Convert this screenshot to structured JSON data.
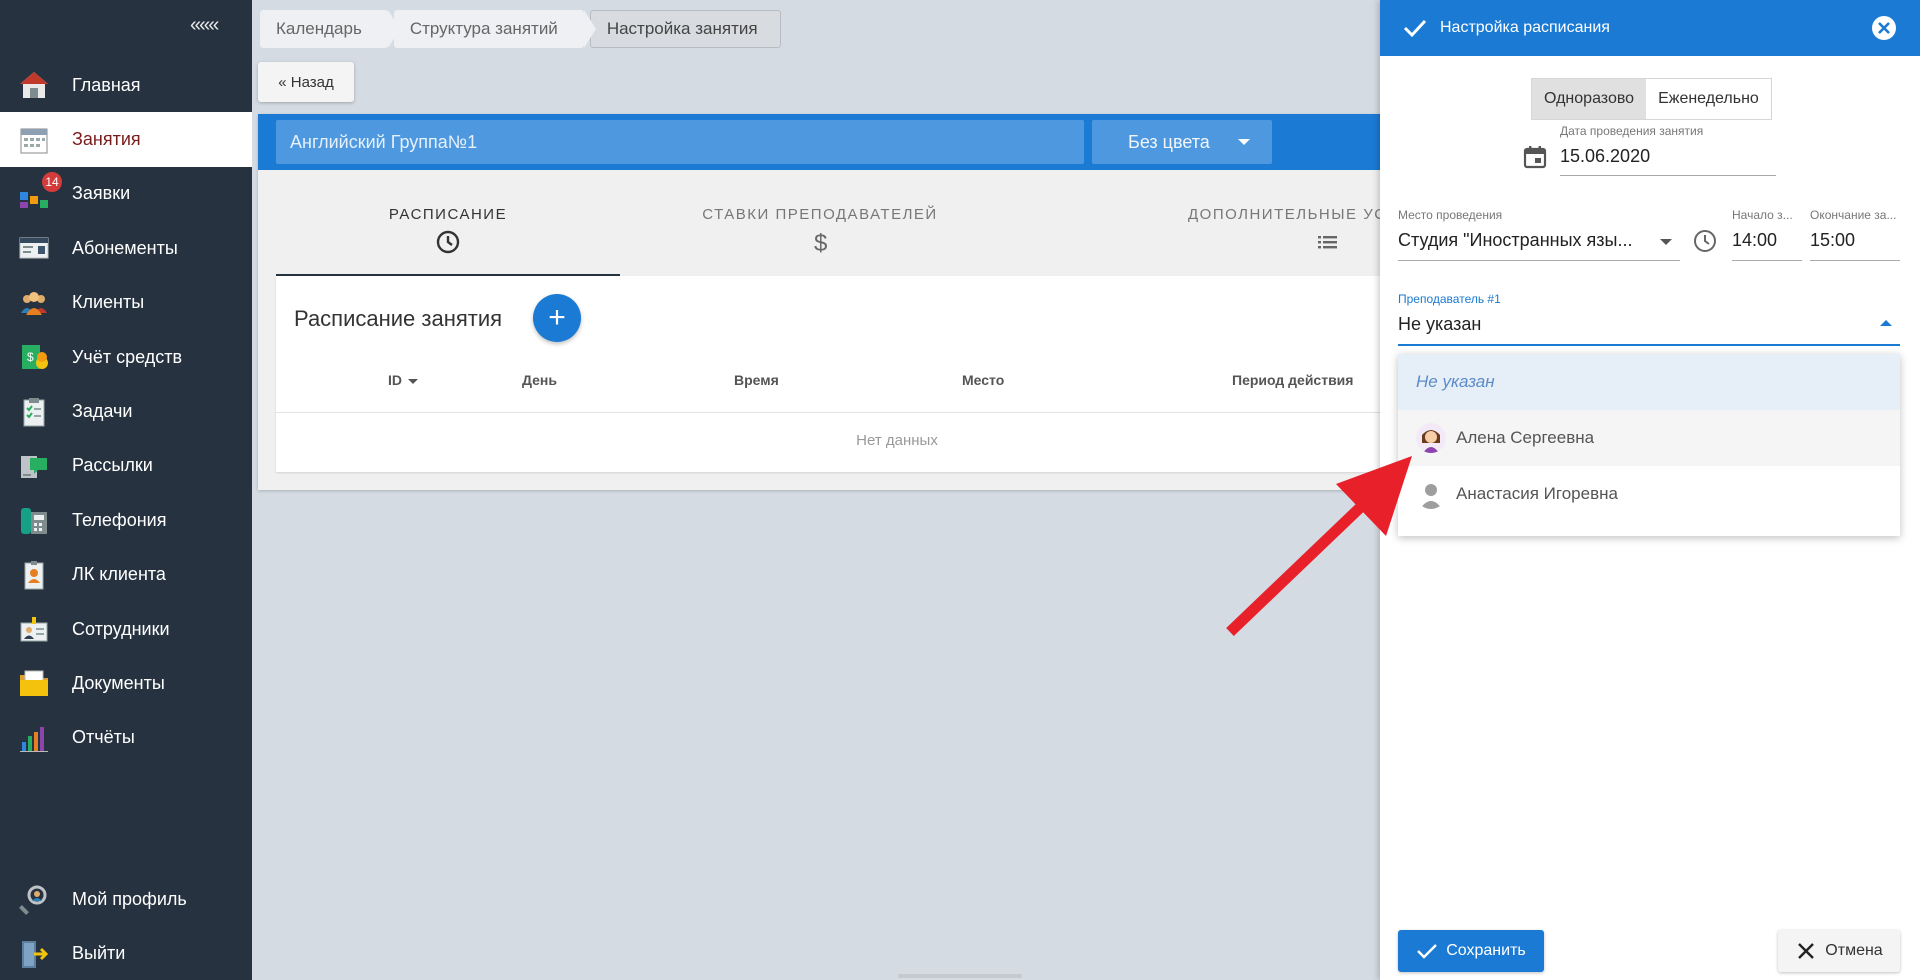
{
  "sidebar": {
    "collapse_label": "«««",
    "items": [
      {
        "label": "Главная",
        "icon": "home-icon"
      },
      {
        "label": "Занятия",
        "icon": "calendar-icon",
        "active": true
      },
      {
        "label": "Заявки",
        "icon": "requests-icon",
        "badge": "14"
      },
      {
        "label": "Абонементы",
        "icon": "subscriptions-icon"
      },
      {
        "label": "Клиенты",
        "icon": "clients-icon"
      },
      {
        "label": "Учёт средств",
        "icon": "finance-icon"
      },
      {
        "label": "Задачи",
        "icon": "tasks-icon"
      },
      {
        "label": "Рассылки",
        "icon": "mailing-icon"
      },
      {
        "label": "Телефония",
        "icon": "telephony-icon"
      },
      {
        "label": "ЛК клиента",
        "icon": "client-account-icon"
      },
      {
        "label": "Сотрудники",
        "icon": "employees-icon"
      },
      {
        "label": "Документы",
        "icon": "documents-icon"
      },
      {
        "label": "Отчёты",
        "icon": "reports-icon"
      }
    ],
    "bottom": [
      {
        "label": "Мой профиль",
        "icon": "profile-icon"
      },
      {
        "label": "Выйти",
        "icon": "logout-icon"
      }
    ]
  },
  "breadcrumbs": [
    "Календарь",
    "Структура занятий",
    "Настройка занятия"
  ],
  "back_label": "« Назад",
  "lesson": {
    "name": "Английский Группа№1",
    "color": "Без цвета"
  },
  "tabs": [
    {
      "label": "РАСПИСАНИЕ",
      "icon": "clock-icon"
    },
    {
      "label": "СТАВКИ ПРЕПОДАВАТЕЛЕЙ",
      "icon": "dollar-icon"
    },
    {
      "label": "ДОПОЛНИТЕЛЬНЫЕ УС...",
      "icon": "list-icon"
    }
  ],
  "schedule": {
    "title": "Расписание занятия",
    "add_label": "+",
    "columns": [
      "ID",
      "День",
      "Время",
      "Место",
      "Период действия"
    ],
    "empty_text": "Нет данных"
  },
  "panel": {
    "title": "Настройка расписания",
    "mode_options": [
      "Одноразово",
      "Еженедельно"
    ],
    "date_label": "Дата проведения занятия",
    "date_value": "15.06.2020",
    "place_label": "Место проведения",
    "place_value": "Студия \"Иностранных язы...",
    "start_label": "Начало з...",
    "start_value": "14:00",
    "end_label": "Окончание за...",
    "end_value": "15:00",
    "teacher_label": "Преподаватель #1",
    "teacher_value": "Не указан",
    "options": [
      "Не указан",
      "Алена Сергеевна",
      "Анастасия Игоревна"
    ],
    "save_label": "Сохранить",
    "cancel_label": "Отмена"
  },
  "colors": {
    "accent": "#1b7ad3",
    "sidebar_bg": "#26323f",
    "arrow": "#e8202a"
  }
}
